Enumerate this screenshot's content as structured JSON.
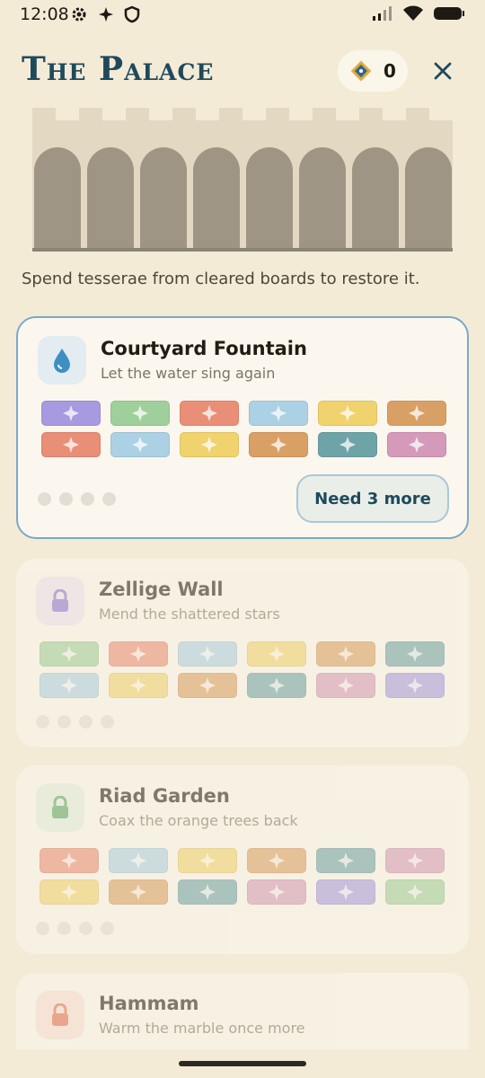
{
  "status": {
    "time": "12:08"
  },
  "header": {
    "title": "The Palace",
    "gem_count": "0"
  },
  "subtitle": "Spend tesserae from cleared boards to restore it.",
  "colors": {
    "purple": "#a79ae0",
    "green": "#9fcf9b",
    "coral": "#e98e77",
    "blue": "#acd1e4",
    "yellow": "#f0d36e",
    "orange": "#d9a066",
    "teal": "#6ea3a8",
    "pink": "#d59aba"
  },
  "cards": [
    {
      "title": "Courtyard Fountain",
      "subtitle": "Let the water sing again",
      "icon": "water-drop-icon",
      "button": "Need 3 more",
      "tiles": [
        "purple",
        "green",
        "coral",
        "blue",
        "yellow",
        "orange",
        "coral",
        "blue",
        "yellow",
        "orange",
        "teal",
        "pink"
      ]
    },
    {
      "title": "Zellige Wall",
      "subtitle": "Mend the shattered stars",
      "icon": "lock-icon",
      "tiles": [
        "green",
        "coral",
        "blue",
        "yellow",
        "orange",
        "teal",
        "blue",
        "yellow",
        "orange",
        "teal",
        "pink",
        "purple"
      ]
    },
    {
      "title": "Riad Garden",
      "subtitle": "Coax the orange trees back",
      "icon": "lock-icon",
      "tiles": [
        "coral",
        "blue",
        "yellow",
        "orange",
        "teal",
        "pink",
        "yellow",
        "orange",
        "teal",
        "pink",
        "purple",
        "green"
      ]
    },
    {
      "title": "Hammam",
      "subtitle": "Warm the marble once more",
      "icon": "lock-icon"
    }
  ]
}
